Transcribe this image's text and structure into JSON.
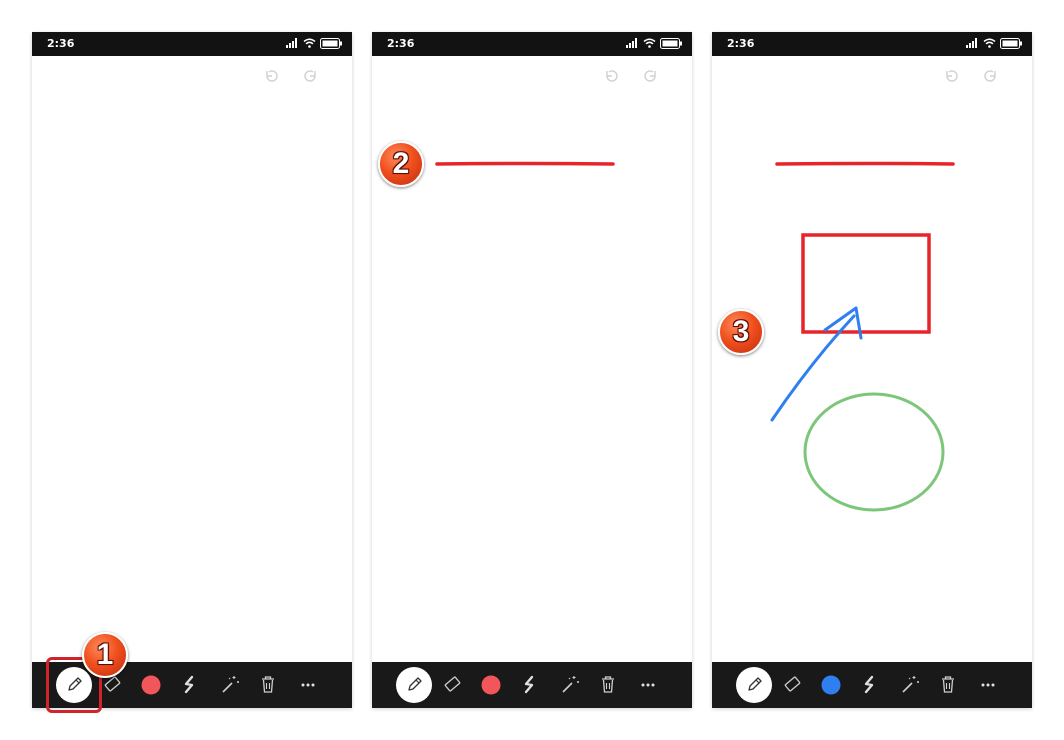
{
  "status_bar": {
    "time": "2:36"
  },
  "toolbar": {
    "more_label": "···"
  },
  "screens": [
    {
      "id": 1,
      "badge": "1",
      "current_color": "#f0565a",
      "strokes": []
    },
    {
      "id": 2,
      "badge": "2",
      "current_color": "#f0565a",
      "strokes": [
        "red-line"
      ]
    },
    {
      "id": 3,
      "badge": "3",
      "current_color": "#2f7ff0",
      "strokes": [
        "red-line",
        "red-rectangle",
        "blue-arrow",
        "green-ellipse"
      ]
    }
  ],
  "colors": {
    "red_stroke": "#e8242b",
    "blue_stroke": "#2f7ff0",
    "green_stroke": "#7cc67a",
    "badge_orange": "#f0501e",
    "highlight_frame": "#d2232a",
    "toolbar_bg": "#191919",
    "status_bar_bg": "#121212"
  }
}
